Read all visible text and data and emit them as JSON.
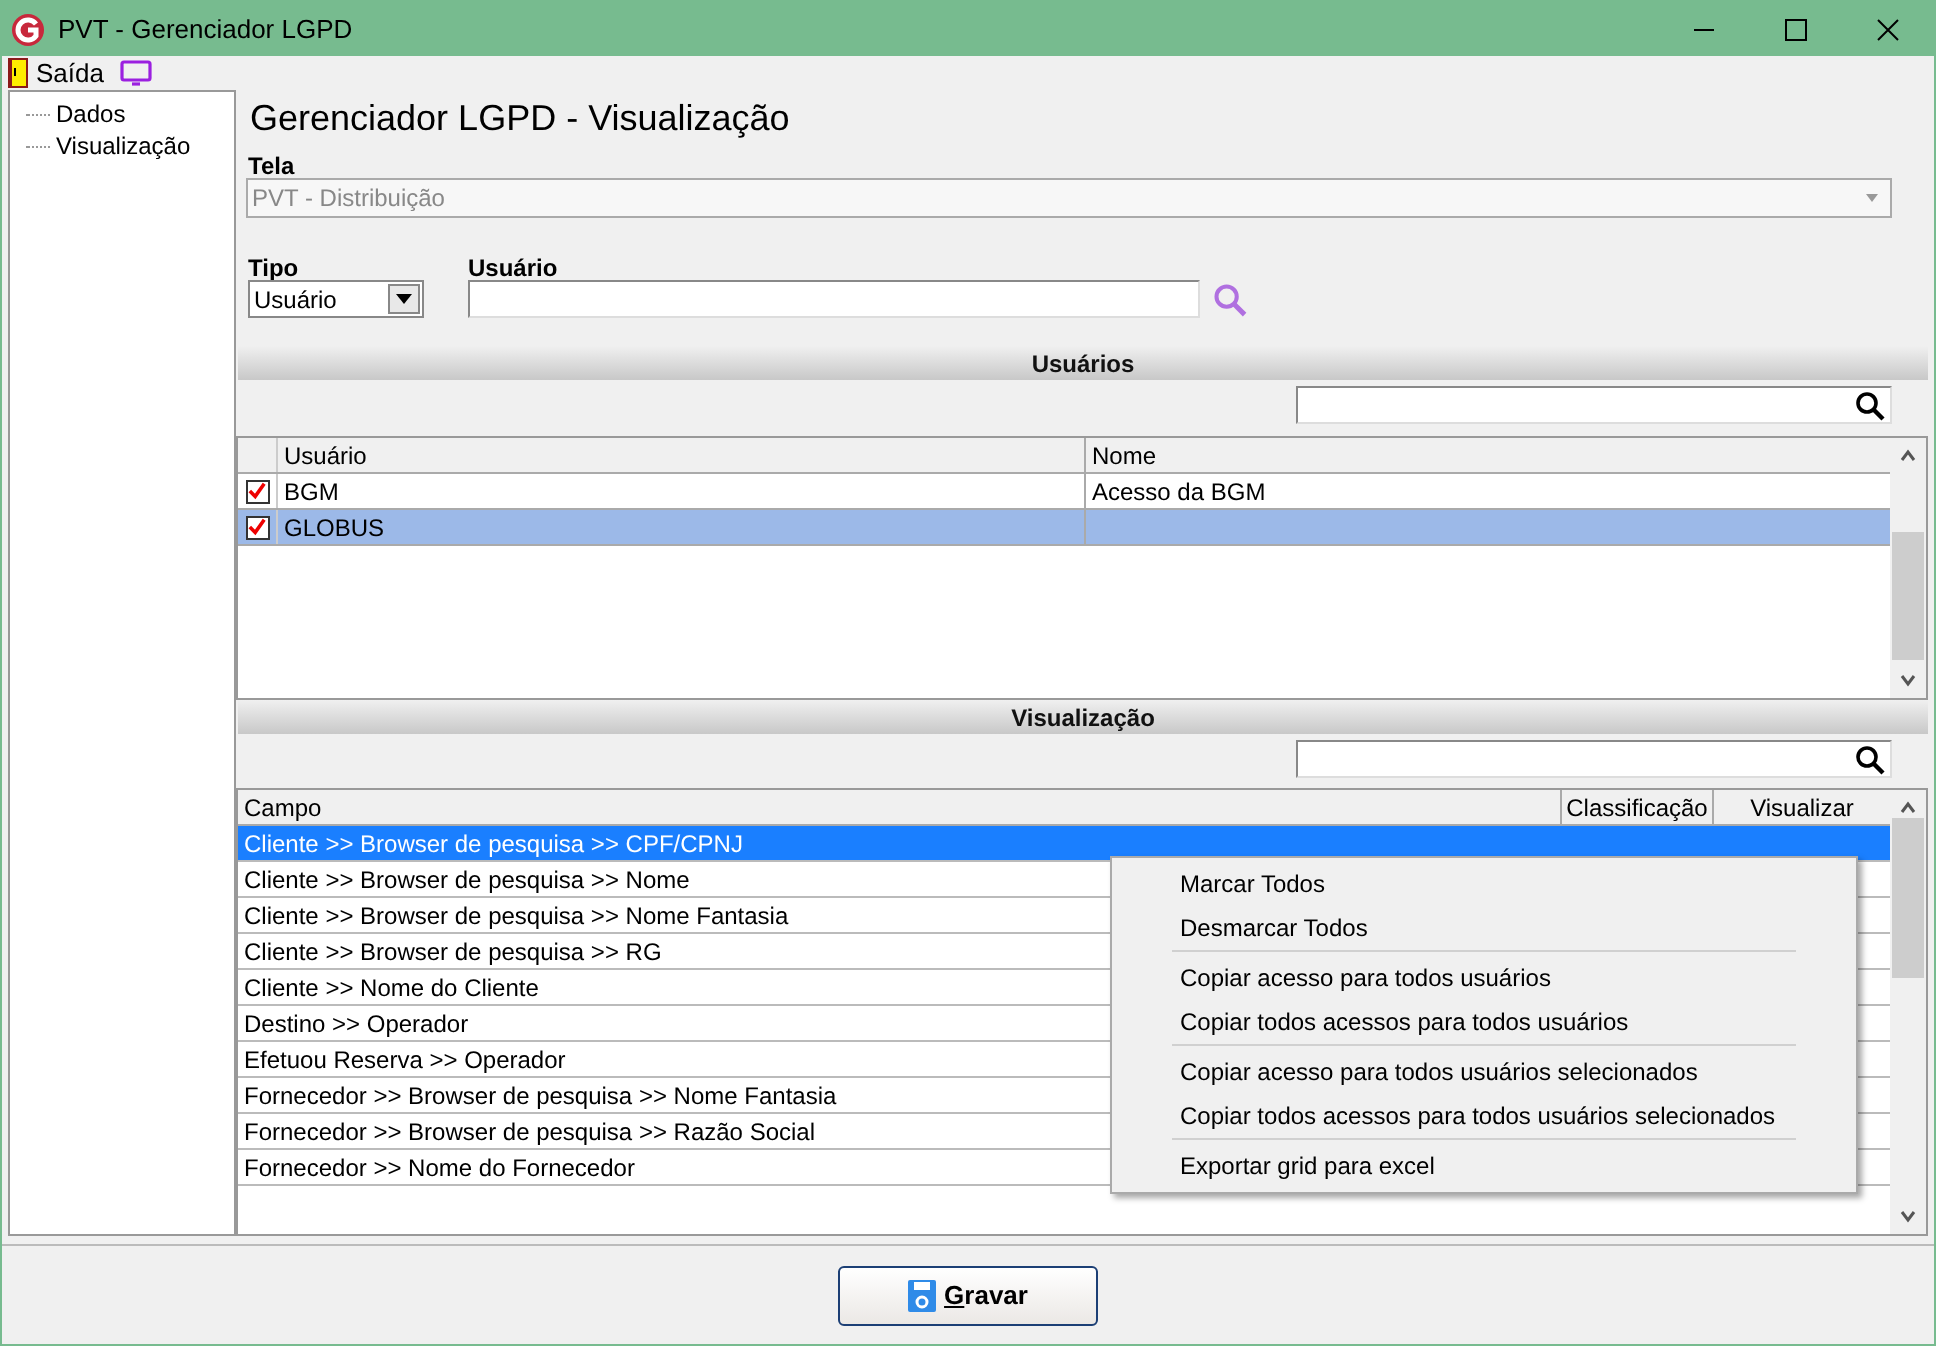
{
  "window": {
    "title": "PVT - Gerenciador LGPD"
  },
  "toolbar": {
    "exit_label": "Saída"
  },
  "sidebar": {
    "items": [
      {
        "label": "Dados",
        "selected": false
      },
      {
        "label": "Visualização",
        "selected": false
      }
    ]
  },
  "heading": "Gerenciador LGPD - Visualização",
  "tela": {
    "label": "Tela",
    "value": "PVT - Distribuição",
    "disabled": true
  },
  "tipo": {
    "label": "Tipo",
    "value": "Usuário"
  },
  "usuario": {
    "label": "Usuário"
  },
  "usuarios": {
    "title": "Usuários",
    "columns": [
      "Usuário",
      "Nome"
    ],
    "rows": [
      {
        "checked": true,
        "usuario": "BGM",
        "nome": "Acesso da BGM",
        "selected": false
      },
      {
        "checked": true,
        "usuario": "GLOBUS",
        "selected": true
      }
    ]
  },
  "visualizacao": {
    "title": "Visualização",
    "columns": [
      "Campo",
      "Classificação",
      "Visualizar"
    ],
    "rows": [
      {
        "campo": "Cliente >> Browser de pesquisa >> CPF/CPNJ",
        "selected": true
      },
      {
        "campo": "Cliente >> Browser de pesquisa >> Nome",
        "selected": false
      },
      {
        "campo": "Cliente >> Browser de pesquisa >> Nome Fantasia",
        "selected": false
      },
      {
        "campo": "Cliente >> Browser de pesquisa >> RG",
        "selected": false
      },
      {
        "campo": "Cliente >> Nome do Cliente",
        "selected": false
      },
      {
        "campo": "Destino >> Operador",
        "selected": false
      },
      {
        "campo": "Efetuou Reserva >> Operador",
        "selected": false
      },
      {
        "campo": "Fornecedor >> Browser de pesquisa >> Nome Fantasia",
        "selected": false
      },
      {
        "campo": "Fornecedor >> Browser de pesquisa >> Razão Social",
        "selected": false
      },
      {
        "campo": "Fornecedor >> Nome do Fornecedor",
        "selected": false
      }
    ]
  },
  "context_menu": {
    "groups": [
      [
        "Marcar Todos",
        "Desmarcar Todos"
      ],
      [
        "Copiar acesso para todos usuários",
        "Copiar todos acessos para todos usuários"
      ],
      [
        "Copiar acesso para todos usuários selecionados",
        "Copiar todos acessos para todos usuários selecionados"
      ],
      [
        "Exportar grid para excel"
      ]
    ]
  },
  "save_button": {
    "label": "Gravar"
  }
}
